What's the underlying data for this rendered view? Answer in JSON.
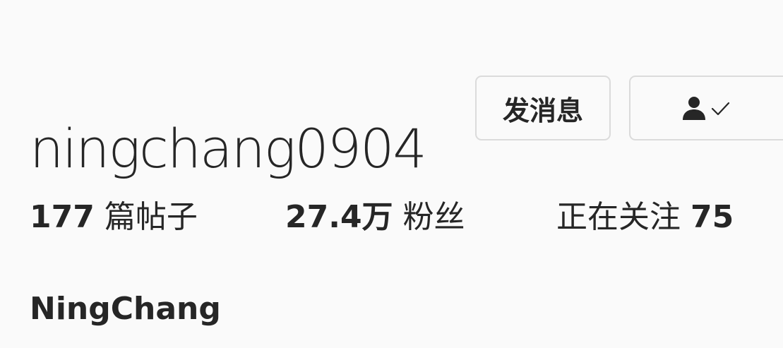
{
  "profile": {
    "username": "ningchang0904",
    "full_name": "NingChang"
  },
  "actions": {
    "message_label": "发消息",
    "following_icon": "person-icon",
    "following_check_icon": "checkmark-icon"
  },
  "stats": {
    "posts_count": "177",
    "posts_label": "篇帖子",
    "followers_count": "27.4万",
    "followers_label": "粉丝",
    "following_label": "正在关注",
    "following_count": "75"
  },
  "colors": {
    "text": "#262626",
    "border": "#dbdbdb",
    "background": "#fafafa"
  }
}
